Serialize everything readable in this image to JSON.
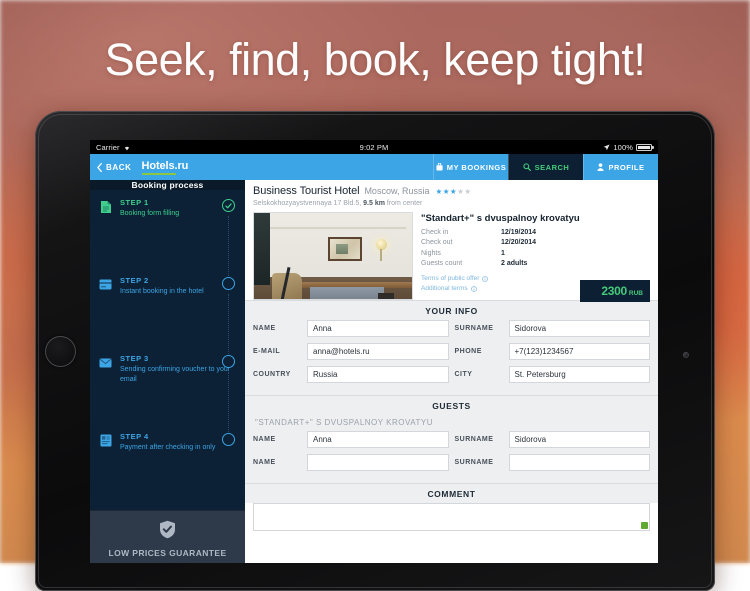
{
  "marketing": {
    "tagline": "Seek, find, book, keep tight!"
  },
  "statusbar": {
    "carrier": "Carrier",
    "wifi_icon": "wifi-icon",
    "time": "9:02 PM",
    "location_icon": "location-arrow-icon",
    "battery": "100%"
  },
  "navbar": {
    "back_label": "BACK",
    "back_icon": "chevron-left-icon",
    "logo": "Hotels.ru",
    "tabs": [
      {
        "label": "MY BOOKINGS",
        "icon": "briefcase-icon",
        "active": false
      },
      {
        "label": "SEARCH",
        "icon": "magnifier-icon",
        "active": true
      },
      {
        "label": "PROFILE",
        "icon": "person-icon",
        "active": false
      }
    ]
  },
  "sidebar": {
    "header": "Booking process",
    "steps": [
      {
        "title": "STEP 1",
        "desc": "Booking form filling",
        "icon": "document-icon",
        "state": "done"
      },
      {
        "title": "STEP 2",
        "desc": "Instant booking in the hotel",
        "icon": "card-icon",
        "state": "pending"
      },
      {
        "title": "STEP 3",
        "desc": "Sending confirming voucher to your email",
        "icon": "envelope-icon",
        "state": "pending"
      },
      {
        "title": "STEP 4",
        "desc": "Payment after checking in only",
        "icon": "invoice-icon",
        "state": "pending"
      }
    ],
    "guarantee": {
      "icon": "shield-check-icon",
      "label": "LOW PRICES GUARANTEE"
    }
  },
  "hotel": {
    "name": "Business Tourist Hotel",
    "city": "Moscow, Russia",
    "stars_filled": 3,
    "stars_total": 5,
    "address": "Selskokhozyaystvennaya 17 Bld.5,",
    "distance": "9.5 km",
    "distance_suffix": "from center",
    "photo_alt": "hotel-room-photo"
  },
  "booking": {
    "room_title": "\"Standart+\" s dvuspalnoy krovatyu",
    "details": [
      {
        "key": "Check in",
        "value": "12/19/2014"
      },
      {
        "key": "Check out",
        "value": "12/20/2014"
      },
      {
        "key": "Nights",
        "value": "1"
      },
      {
        "key": "Guests count",
        "value": "2 adults"
      }
    ],
    "terms": [
      {
        "label": "Terms of public offer",
        "icon": "info-icon"
      },
      {
        "label": "Additional terms",
        "icon": "info-icon"
      }
    ],
    "price_value": "2300",
    "price_currency": "RUB"
  },
  "your_info": {
    "heading": "YOUR INFO",
    "fields": {
      "name_label": "NAME",
      "name_value": "Anna",
      "surname_label": "SURNAME",
      "surname_value": "Sidorova",
      "email_label": "E-MAIL",
      "email_value": "anna@hotels.ru",
      "phone_label": "PHONE",
      "phone_value": "+7(123)1234567",
      "country_label": "COUNTRY",
      "country_value": "Russia",
      "city_label": "CITY",
      "city_value": "St. Petersburg"
    }
  },
  "guests": {
    "heading": "GUESTS",
    "room_label": "\"STANDART+\" S DVUSPALNOY KROVATYU",
    "rows": [
      {
        "name_label": "NAME",
        "name_value": "Anna",
        "surname_label": "SURNAME",
        "surname_value": "Sidorova"
      },
      {
        "name_label": "NAME",
        "name_value": "",
        "surname_label": "SURNAME",
        "surname_value": ""
      }
    ]
  },
  "comment": {
    "heading": "COMMENT",
    "value": ""
  },
  "colors": {
    "brand_blue": "#3ca5e6",
    "brand_green": "#8dc63f",
    "accent_green": "#45c97a",
    "dark_navy": "#0d2033",
    "sidebar_navy": "#0c2135"
  }
}
